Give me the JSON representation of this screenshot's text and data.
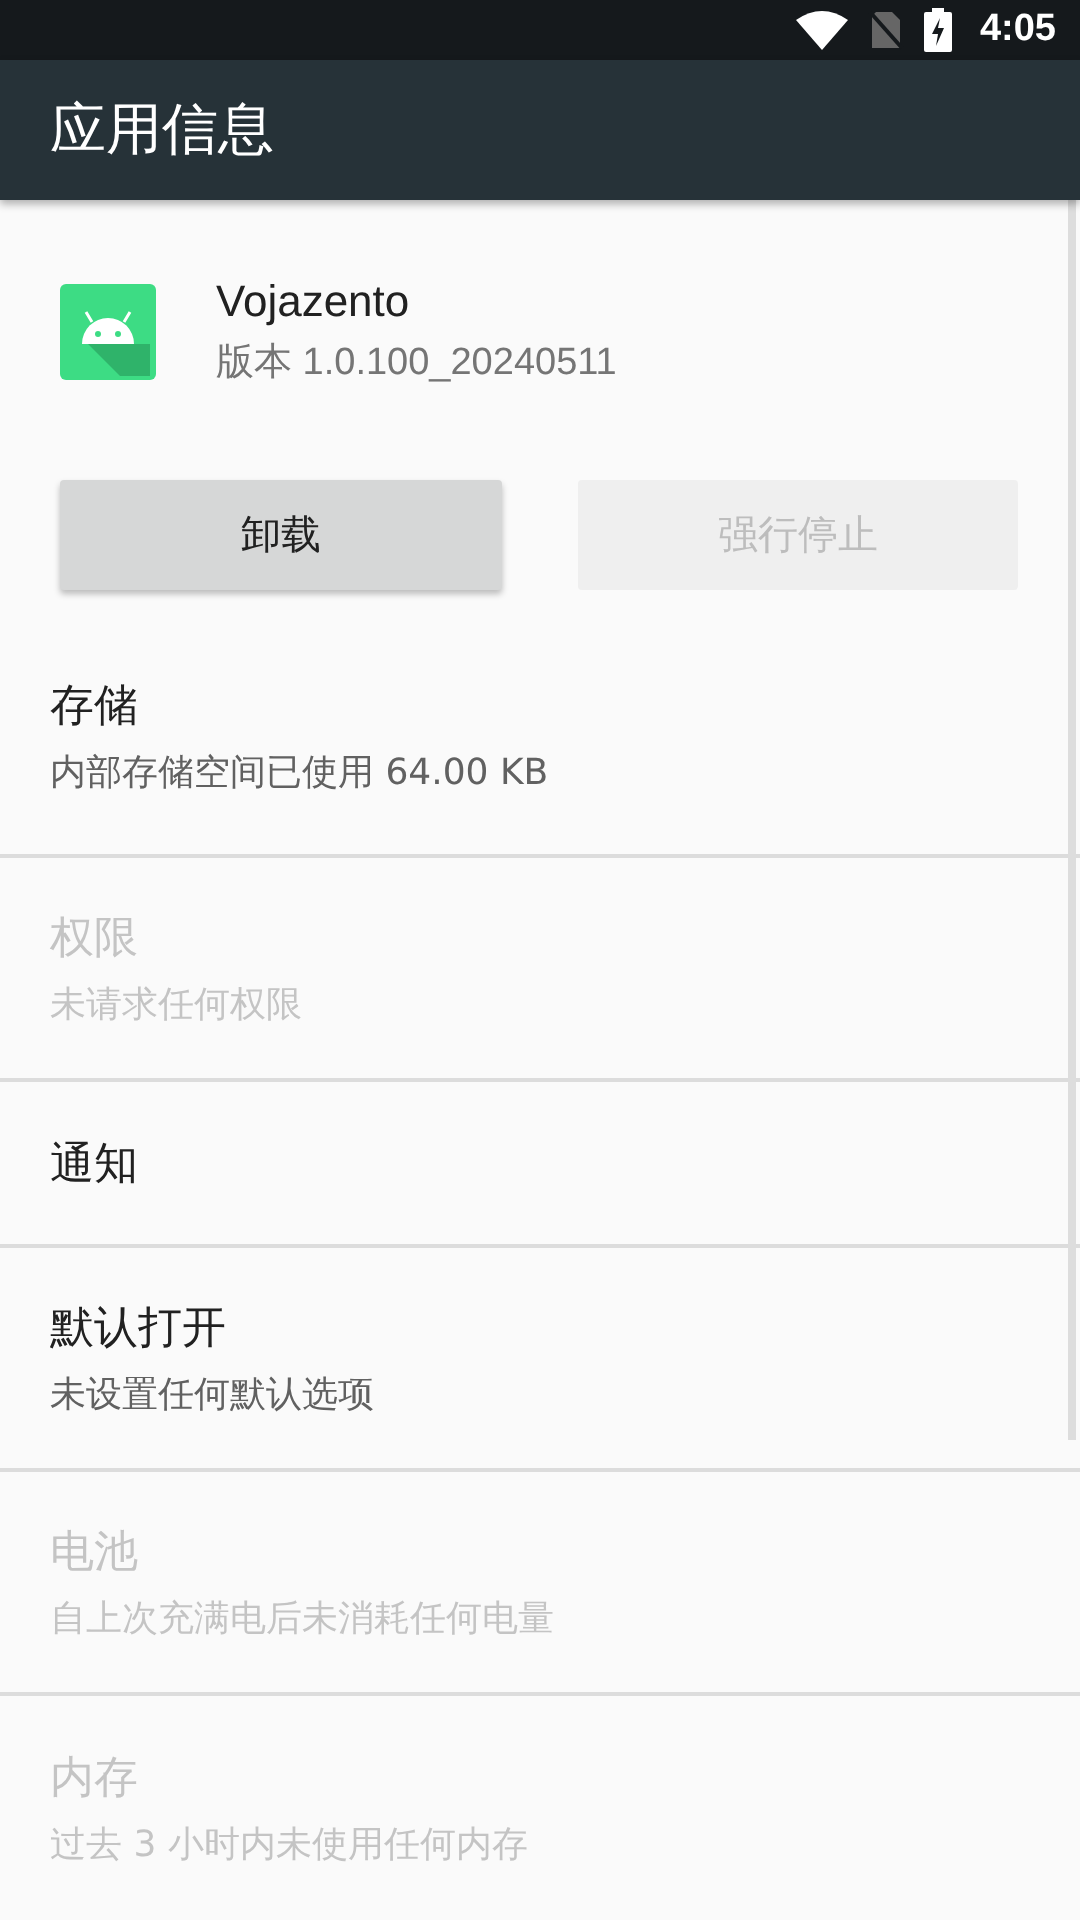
{
  "status_bar": {
    "time": "4:05"
  },
  "app_bar": {
    "title": "应用信息"
  },
  "app": {
    "name": "Vojazento",
    "version": "版本 1.0.100_20240511"
  },
  "buttons": [
    {
      "label": "卸载",
      "disabled": false
    },
    {
      "label": "强行停止",
      "disabled": true
    }
  ],
  "items": [
    {
      "title": "存储",
      "summary": "内部存储空间已使用 64.00 KB",
      "disabled": false
    },
    {
      "title": "权限",
      "summary": "未请求任何权限",
      "disabled": true
    },
    {
      "title": "通知",
      "disabled": false
    },
    {
      "title": "默认打开",
      "summary": "未设置任何默认选项",
      "disabled": false
    },
    {
      "title": "电池",
      "summary": "自上次充满电后未消耗任何电量",
      "disabled": true
    },
    {
      "title": "内存",
      "summary": "过去 3 小时内未使用任何内存",
      "disabled": true
    }
  ]
}
